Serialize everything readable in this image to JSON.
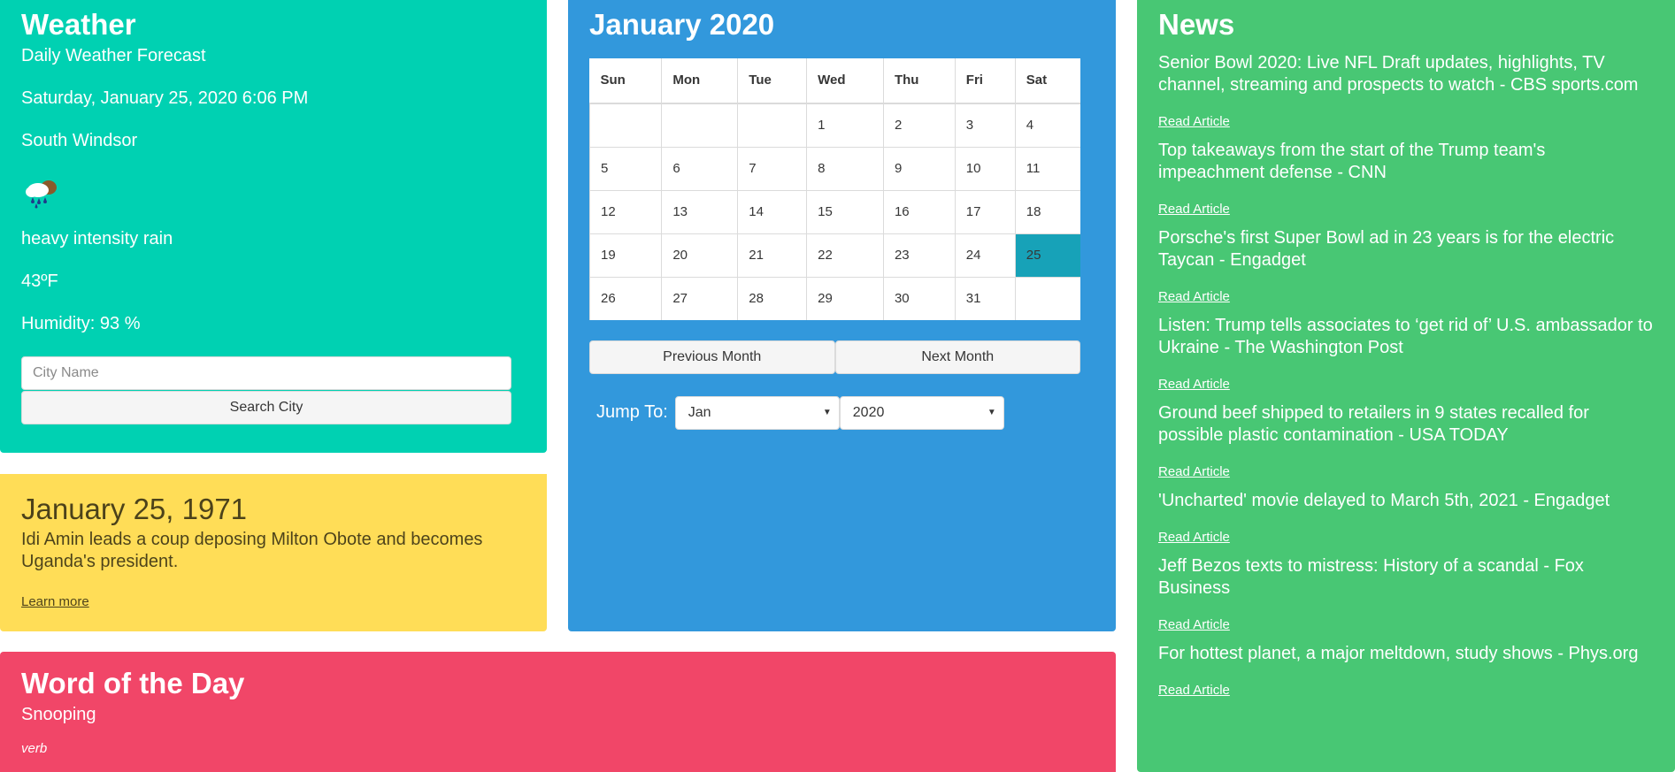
{
  "weather": {
    "title": "Weather",
    "subtitle": "Daily Weather Forecast",
    "datetime": "Saturday, January 25, 2020 6:06 PM",
    "location": "South Windsor",
    "icon": "rain-cloud-icon",
    "description": "heavy intensity rain",
    "temperature": "43ºF",
    "humidity": "Humidity: 93 %",
    "city_placeholder": "City Name",
    "search_label": "Search City"
  },
  "history": {
    "date": "January 25, 1971",
    "text": "Idi Amin leads a coup deposing Milton Obote and becomes Uganda's president.",
    "link": "Learn more"
  },
  "calendar": {
    "title": "January 2020",
    "headers": [
      "Sun",
      "Mon",
      "Tue",
      "Wed",
      "Thu",
      "Fri",
      "Sat"
    ],
    "weeks": [
      [
        "",
        "",
        "",
        "1",
        "2",
        "3",
        "4"
      ],
      [
        "5",
        "6",
        "7",
        "8",
        "9",
        "10",
        "11"
      ],
      [
        "12",
        "13",
        "14",
        "15",
        "16",
        "17",
        "18"
      ],
      [
        "19",
        "20",
        "21",
        "22",
        "23",
        "24",
        "25"
      ],
      [
        "26",
        "27",
        "28",
        "29",
        "30",
        "31",
        ""
      ]
    ],
    "highlighted_day": "25",
    "prev_label": "Previous Month",
    "next_label": "Next Month",
    "jump_label": "Jump To:",
    "month_select": "Jan",
    "year_select": "2020"
  },
  "word": {
    "title": "Word of the Day",
    "word": "Snooping",
    "type": "verb"
  },
  "news": {
    "title": "News",
    "link_label": "Read Article",
    "items": [
      "Senior Bowl 2020: Live NFL Draft updates, highlights, TV channel, streaming and prospects to watch - CBS sports.com",
      "Top takeaways from the start of the Trump team's impeachment defense - CNN",
      "Porsche's first Super Bowl ad in 23 years is for the electric Taycan - Engadget",
      "Listen: Trump tells associates to ‘get rid of’ U.S. ambassador to Ukraine - The Washington Post",
      "Ground beef shipped to retailers in 9 states recalled for possible plastic contamination - USA TODAY",
      "'Uncharted' movie delayed to March 5th, 2021 - Engadget",
      "Jeff Bezos texts to mistress: History of a scandal - Fox Business",
      "For hottest planet, a major meltdown, study shows - Phys.org"
    ]
  },
  "colors": {
    "weather": "#00d1b2",
    "history": "#ffdd57",
    "calendar": "#3298dc",
    "word": "#f14668",
    "news": "#48c774",
    "today": "#17a2b8"
  }
}
